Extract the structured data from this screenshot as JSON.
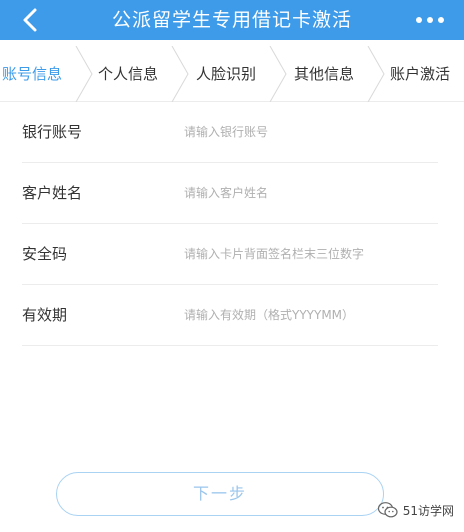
{
  "header": {
    "title": "公派留学生专用借记卡激活",
    "back_icon": "chevron-left-icon",
    "more_icon": "more-dots-icon",
    "color": "#3d9be9"
  },
  "steps": [
    {
      "label": "账号信息",
      "active": true
    },
    {
      "label": "个人信息",
      "active": false
    },
    {
      "label": "人脸识别",
      "active": false
    },
    {
      "label": "其他信息",
      "active": false
    },
    {
      "label": "账户激活",
      "active": false
    }
  ],
  "form": {
    "fields": [
      {
        "label": "银行账号",
        "placeholder": "请输入银行账号",
        "value": ""
      },
      {
        "label": "客户姓名",
        "placeholder": "请输入客户姓名",
        "value": ""
      },
      {
        "label": "安全码",
        "placeholder": "请输入卡片背面签名栏末三位数字",
        "value": ""
      },
      {
        "label": "有效期",
        "placeholder": "请输入有效期（格式YYYYMM）",
        "value": ""
      }
    ]
  },
  "next_button": {
    "label": "下一步"
  },
  "watermark": {
    "text": "51访学网",
    "icon": "wechat-logo-icon"
  },
  "colors": {
    "accent": "#3d9be9",
    "button_border": "#a9d2f3",
    "placeholder": "#b0b0b0"
  }
}
